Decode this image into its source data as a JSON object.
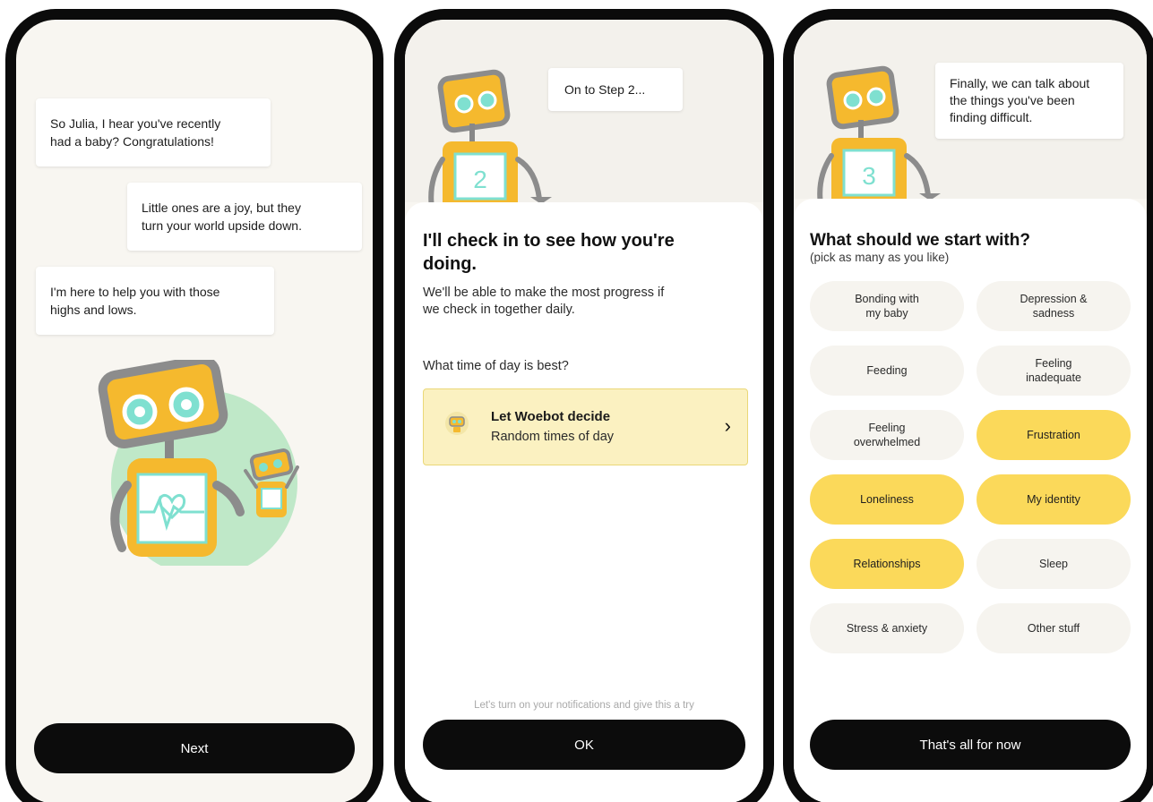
{
  "colors": {
    "accent_yellow": "#fbd95a",
    "card_yellow": "#fbf1c1",
    "robot_yellow": "#f5b92e",
    "robot_teal": "#7fe0d0",
    "bg": "#f8f6f1",
    "button_black": "#0c0c0c"
  },
  "screen1": {
    "bubbles": [
      {
        "lines": [
          "So Julia, I hear you've recently",
          "had a baby? Congratulations!"
        ]
      },
      {
        "lines": [
          "Little ones are a joy, but they",
          "turn your world upside down."
        ]
      },
      {
        "lines": [
          "I'm here to help you with those",
          "highs and lows."
        ]
      }
    ],
    "illustration_icon": "robot-heart-monitor-icon",
    "button_label": "Next"
  },
  "screen2": {
    "speech": "On to Step 2...",
    "step_number": "2",
    "heading": [
      "I'll check in to see how you're",
      "doing."
    ],
    "body": [
      "We'll be able to make the most progress if",
      "we check in together daily."
    ],
    "question": "What time of day is best?",
    "option": {
      "title": "Let Woebot decide",
      "subtitle": "Random times of day",
      "icon": "woebot-mini-icon"
    },
    "hint": "Let's turn on your notifications and give this a try",
    "button_label": "OK"
  },
  "screen3": {
    "speech": [
      "Finally, we can talk about",
      "the things you've been",
      "finding difficult."
    ],
    "step_number": "3",
    "heading": "What should we start with?",
    "subheading": "(pick as many as you like)",
    "options": [
      {
        "lines": [
          "Bonding with",
          "my baby"
        ],
        "selected": false
      },
      {
        "lines": [
          "Depression &",
          "sadness"
        ],
        "selected": false
      },
      {
        "lines": [
          "Feeding"
        ],
        "selected": false
      },
      {
        "lines": [
          "Feeling",
          "inadequate"
        ],
        "selected": false
      },
      {
        "lines": [
          "Feeling",
          "overwhelmed"
        ],
        "selected": false
      },
      {
        "lines": [
          "Frustration"
        ],
        "selected": true
      },
      {
        "lines": [
          "Loneliness"
        ],
        "selected": true
      },
      {
        "lines": [
          "My identity"
        ],
        "selected": true
      },
      {
        "lines": [
          "Relationships"
        ],
        "selected": true
      },
      {
        "lines": [
          "Sleep"
        ],
        "selected": false
      },
      {
        "lines": [
          "Stress & anxiety"
        ],
        "selected": false
      },
      {
        "lines": [
          "Other stuff"
        ],
        "selected": false
      }
    ],
    "button_label": "That's all for now"
  }
}
